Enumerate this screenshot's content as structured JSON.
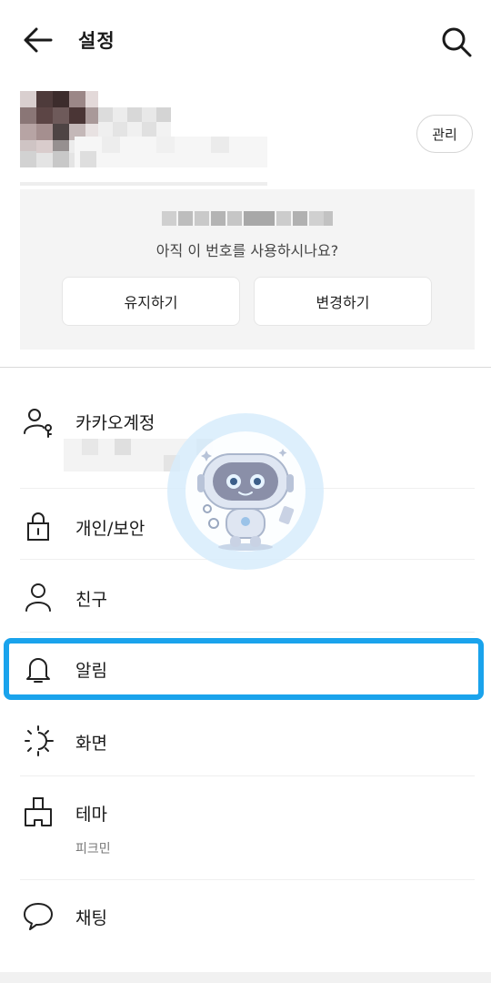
{
  "header": {
    "title": "설정",
    "back_icon": "arrow-left-icon",
    "search_icon": "search-icon"
  },
  "profile": {
    "manage_label": "관리"
  },
  "phone_card": {
    "question": "아직 이 번호를 사용하시나요?",
    "keep_label": "유지하기",
    "change_label": "변경하기"
  },
  "menu": {
    "items": [
      {
        "label": "카카오계정",
        "icon": "person-key-icon"
      },
      {
        "label": "개인/보안",
        "icon": "lock-icon"
      },
      {
        "label": "친구",
        "icon": "person-icon"
      },
      {
        "label": "알림",
        "icon": "bell-icon"
      },
      {
        "label": "화면",
        "icon": "brightness-icon"
      },
      {
        "label": "테마",
        "icon": "brush-icon",
        "sub": "피크민"
      },
      {
        "label": "채팅",
        "icon": "chat-bubble-icon"
      }
    ]
  },
  "colors": {
    "highlight": "#1aa3ec",
    "card_bg": "#f4f4f4"
  }
}
